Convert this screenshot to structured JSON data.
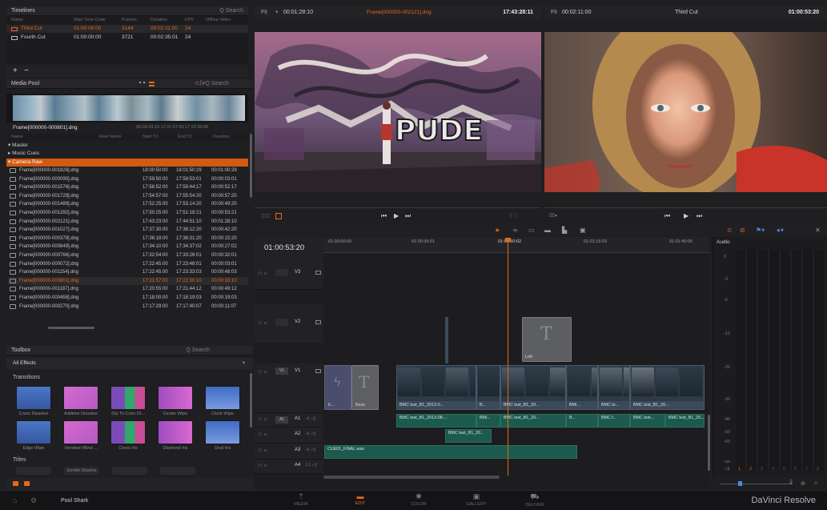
{
  "timelines": {
    "title": "Timelines",
    "search": "Q Search",
    "cols": [
      "Name",
      "Start Time Code",
      "Frames",
      "Duration",
      "FPS",
      "Offline Video"
    ],
    "rows": [
      {
        "name": "Third Cut",
        "start": "01:00:00:00",
        "frames": "3144",
        "duration": "00:02:11:00",
        "fps": "24"
      },
      {
        "name": "Fourth Cut",
        "start": "01:00:00:00",
        "frames": "3721",
        "duration": "00:02:35:01",
        "fps": "24"
      }
    ],
    "add": "+",
    "remove": "−"
  },
  "media_pool": {
    "title": "Media Pool",
    "search": "Q Search",
    "clip_name": "Frame[000000-000801].dng",
    "clip_tc": "00:00:33:10  17:21:57:00  17:22:30:09",
    "cols": [
      "Name",
      "Reel Name",
      "Start TC",
      "End TC",
      "Duration"
    ],
    "bins": [
      "Master",
      "Music Cues",
      "Camera Raw"
    ],
    "rows": [
      [
        "Frame[000000-001828].dng",
        "18:00:50:00",
        "18:01:50:29",
        "00:01:00:29"
      ],
      [
        "Frame[000000-000090].dng",
        "17:59:50:00",
        "17:59:53:01",
        "00:00:03:01"
      ],
      [
        "Frame[000000-001576].dng",
        "17:58:52:00",
        "17:59:44:17",
        "00:00:52:17"
      ],
      [
        "Frame[000000-001729].dng",
        "17:54:57:00",
        "17:55:54:20",
        "00:00:57:20"
      ],
      [
        "Frame[000000-001489].dng",
        "17:52:25:00",
        "17:53:14:20",
        "00:00:49:20"
      ],
      [
        "Frame[000000-001292].dng",
        "17:50:25:00",
        "17:51:18:21",
        "00:00:53:21"
      ],
      [
        "Frame[000000-002121].dng",
        "17:43:23:00",
        "17:44:51:10",
        "00:01:28:10"
      ],
      [
        "Frame[000000-001027].dng",
        "17:37:30:00",
        "17:38:12:20",
        "00:00:42:20"
      ],
      [
        "Frame[000000-000378].dng",
        "17:36:18:00",
        "17:36:31:20",
        "00:00:15:20"
      ],
      [
        "Frame[000000-000849].dng",
        "17:34:10:00",
        "17:34:37:02",
        "00:00:27:02"
      ],
      [
        "Frame[000000-000766].dng",
        "17:32:54:00",
        "17:33:26:01",
        "00:00:32:01"
      ],
      [
        "Frame[000000-000072].dng",
        "17:22:45:00",
        "17:23:48:01",
        "00:00:03:01"
      ],
      [
        "Frame[000000-001154].dng",
        "17:22:45:00",
        "17:23:33:03",
        "00:00:48:03"
      ],
      [
        "Frame[000000-000801].dng",
        "17:21:57:00",
        "17:22:30:10",
        "00:00:33:10"
      ],
      [
        "Frame[000000-001187].dng",
        "17:20:55:00",
        "17:21:44:12",
        "00:00:49:12"
      ],
      [
        "Frame[000000-000458].dng",
        "17:18:00:00",
        "17:18:19:03",
        "00:00:19:03"
      ],
      [
        "Frame[000000-000270].dng",
        "17:17:29:00",
        "17:17:40:07",
        "00:00:11:07"
      ]
    ]
  },
  "toolbox": {
    "title": "Toolbox",
    "search": "Q Search",
    "filter": "All Effects",
    "transitions_label": "Transitions",
    "titles_label": "Titles",
    "transitions": [
      "Cross Dissolve",
      "Additive Dissolve",
      "Dip To Color Di...",
      "Center Wipe",
      "Clock Wipe",
      "Edge Wipe",
      "Venetian Blind ...",
      "Cross Iris",
      "Diamond Iris",
      "Oval Iris"
    ],
    "titles": [
      "Scroller Dissolve"
    ]
  },
  "source_viewer": {
    "fit": "Fit",
    "tc": "00:01:28:10",
    "clip": "Frame[000000-002121].dng",
    "tc2": "17:43:28:11"
  },
  "timeline_viewer": {
    "fit": "Fit",
    "tc": "00:02:11:00",
    "name": "Third Cut",
    "tc2": "01:00:53:20"
  },
  "timeline": {
    "timecode": "01:00:53:20",
    "ruler": [
      "01:00:00:00",
      "01:00:35:01",
      "01:00:50:02",
      "01:01:15:03",
      "01:01:40:05"
    ],
    "tracks": [
      "V3",
      "V2",
      "V1",
      "A1",
      "A2",
      "A3",
      "A4"
    ],
    "title_clip": "Left",
    "title_letter": "T",
    "basic": "Basic",
    "e_label": "E...",
    "video_clips": [
      "BMC test_B1_2013-0...",
      "B...",
      "BMC test_B1_20...",
      "BMI...",
      "BMC te...",
      "BMC test_B1_20..."
    ],
    "audio_a1": [
      "BMC test_B1_2013-08-...",
      "BMI...",
      "BMC test_B1_20...",
      "B...",
      "BMC t...",
      "BMC test...",
      "BMC test_B1_20..."
    ],
    "audio_a2": "BMC test_B1_20...",
    "audio_a3": "CUE01_FINAL.wav"
  },
  "audio_panel": {
    "title": "Audio",
    "scale": [
      "0",
      "-3",
      "-6",
      "-12",
      "-20",
      "-30",
      "-40",
      "-50",
      "-60",
      "-oo"
    ],
    "channels": [
      "1",
      "2",
      "3",
      "4",
      "5",
      "6",
      "7",
      "8"
    ]
  },
  "nav": {
    "project": "Pool Shark",
    "pages": [
      "MEDIA",
      "EDIT",
      "COLOR",
      "GALLERY",
      "DELIVER"
    ],
    "active": "EDIT",
    "brand": "DaVinci Resolve"
  },
  "colors": {
    "accent": "#e8681a",
    "highlight_row": "#2a3340",
    "audio_clip": "#1d5a4e",
    "video_clip": "#2d3a48",
    "playhead": "#e06a1a"
  }
}
